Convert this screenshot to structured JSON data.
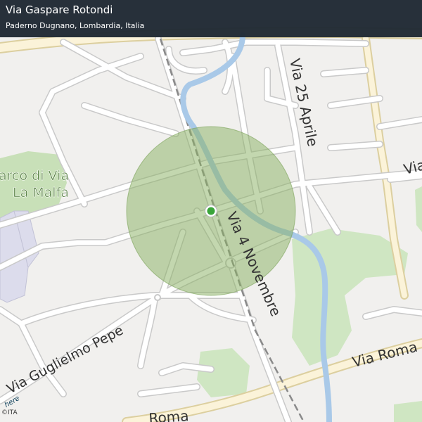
{
  "header": {
    "title": "Via Gaspare Rotondi",
    "subtitle": "Paderno Dugnano, Lombardia, Italia"
  },
  "map": {
    "labels": {
      "via_25_aprile": "Via 25 Aprile",
      "via_4_novembre": "Via 4 Novembre",
      "via_guglielmo_pepe": "Via Guglielmo Pepe",
      "via_roma_east": "Via Roma",
      "roma_south": "Roma",
      "parco_line1": "arco di Via",
      "parco_line2": "La Malfa",
      "via_edge": "Via"
    },
    "colors": {
      "background": "#f1f0ee",
      "park": "#c5dfb5",
      "water": "#a9c9e8",
      "accuracy_circle": "#8fb36a",
      "location_dot": "#3aa53a",
      "building": "#dcdcec"
    },
    "location_dot_icon": "location-dot-icon"
  },
  "attribution": {
    "logo": "here",
    "copyright": "©ITA"
  }
}
